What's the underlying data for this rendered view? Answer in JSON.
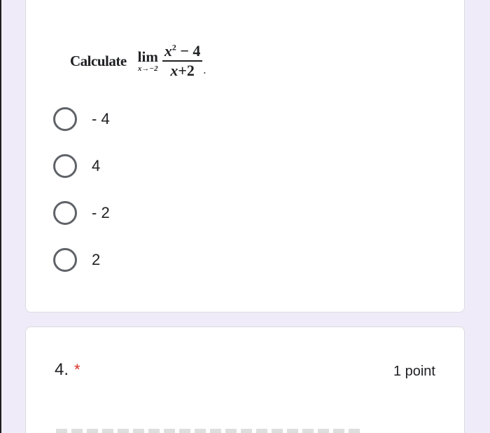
{
  "question3": {
    "prefix": "Calculate",
    "limit_word": "lim",
    "limit_sub": "x→−2",
    "numerator_var": "x",
    "numerator_exp": "2",
    "numerator_rest": " − 4",
    "denominator_var": "x",
    "denominator_rest": "+2",
    "end_punct": ".",
    "options": [
      {
        "label": "- 4"
      },
      {
        "label": "4"
      },
      {
        "label": "- 2"
      },
      {
        "label": "2"
      }
    ]
  },
  "question4": {
    "number": "4.",
    "required_mark": "*",
    "points": "1 point"
  },
  "colors": {
    "page_background": "#f0ebf8",
    "card_background": "#ffffff",
    "radio_border": "#5f6368",
    "required": "#d93025"
  }
}
